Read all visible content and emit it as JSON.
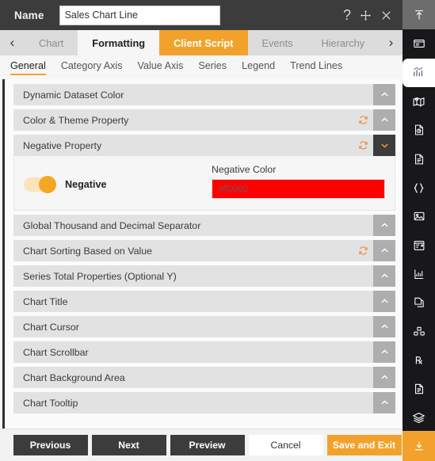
{
  "header": {
    "name_label": "Name",
    "name_value": "Sales Chart Line",
    "help_icon": "question-mark-icon",
    "move_icon": "move-icon",
    "close_icon": "close-icon"
  },
  "tabs": {
    "prev_arrow": "‹",
    "next_arrow": "›",
    "items": [
      {
        "label": "Chart",
        "state": "normal"
      },
      {
        "label": "Formatting",
        "state": "selected"
      },
      {
        "label": "Client Script",
        "state": "accent"
      },
      {
        "label": "Events",
        "state": "normal"
      },
      {
        "label": "Hierarchy",
        "state": "clipped"
      }
    ]
  },
  "subtabs": {
    "items": [
      {
        "label": "General",
        "selected": true
      },
      {
        "label": "Category Axis",
        "selected": false
      },
      {
        "label": "Value Axis",
        "selected": false
      },
      {
        "label": "Series",
        "selected": false
      },
      {
        "label": "Legend",
        "selected": false
      },
      {
        "label": "Trend Lines",
        "selected": false
      }
    ]
  },
  "sections": [
    {
      "title": "Dynamic Dataset Color",
      "refresh": false,
      "expanded": false
    },
    {
      "title": "Color & Theme Property",
      "refresh": true,
      "expanded": false
    },
    {
      "title": "Negative Property",
      "refresh": true,
      "expanded": true
    },
    {
      "title": "Global Thousand and Decimal Separator",
      "refresh": false,
      "expanded": false
    },
    {
      "title": "Chart Sorting Based on Value",
      "refresh": true,
      "expanded": false
    },
    {
      "title": "Series Total Properties (Optional Y)",
      "refresh": false,
      "expanded": false
    },
    {
      "title": "Chart Title",
      "refresh": false,
      "expanded": false
    },
    {
      "title": "Chart Cursor",
      "refresh": false,
      "expanded": false
    },
    {
      "title": "Chart Scrollbar",
      "refresh": false,
      "expanded": false
    },
    {
      "title": "Chart Background Area",
      "refresh": false,
      "expanded": false
    },
    {
      "title": "Chart Tooltip",
      "refresh": false,
      "expanded": false
    }
  ],
  "negative_panel": {
    "toggle_label": "Negative",
    "toggle_on": true,
    "color_label": "Negative Color",
    "color_value": "#ff0000",
    "color_swatch": "#ff0000"
  },
  "footer": {
    "previous": "Previous",
    "next": "Next",
    "preview": "Preview",
    "cancel": "Cancel",
    "save_and_exit": "Save and Exit"
  },
  "rail": {
    "top_icon": "collapse-up-icon",
    "items": [
      "layout-panel-icon",
      "chart-bars-icon",
      "map-icon",
      "document-chart-icon",
      "document-text-icon",
      "code-braces-icon",
      "image-icon",
      "form-layout-icon",
      "line-chart-icon",
      "copy-page-icon",
      "blocks-icon",
      "prescription-icon",
      "report-icon",
      "layers-icon",
      "grid-apps-icon"
    ],
    "bottom_icon": "download-icon"
  },
  "colors": {
    "accent": "#f2a22c",
    "dark": "#3c3c3c",
    "rail_bg": "#18181a",
    "negative": "#ff0000"
  }
}
